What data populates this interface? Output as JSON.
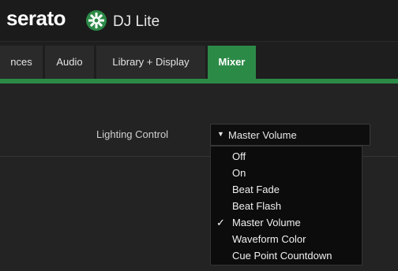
{
  "app": {
    "brand": "serato",
    "product": "DJ Lite"
  },
  "tabs": [
    {
      "label": "nces",
      "active": false
    },
    {
      "label": "Audio",
      "active": false
    },
    {
      "label": "Library + Display",
      "active": false
    },
    {
      "label": "Mixer",
      "active": true
    }
  ],
  "lighting": {
    "label": "Lighting Control",
    "selected": "Master Volume",
    "options": [
      {
        "label": "Off",
        "checked": false
      },
      {
        "label": "On",
        "checked": false
      },
      {
        "label": "Beat Fade",
        "checked": false
      },
      {
        "label": "Beat Flash",
        "checked": false
      },
      {
        "label": "Master Volume",
        "checked": true
      },
      {
        "label": "Waveform Color",
        "checked": false
      },
      {
        "label": "Cue Point Countdown",
        "checked": false
      }
    ],
    "check_mark": "✓",
    "arrow_glyph": "▼"
  },
  "colors": {
    "accent": "#2c8a47",
    "background": "#232323",
    "menu_bg": "#0c0c0c"
  },
  "icons": {
    "logo": "serato-gear-logo-icon",
    "dropdown": "dropdown-triangle-icon",
    "check": "checkmark-icon"
  }
}
